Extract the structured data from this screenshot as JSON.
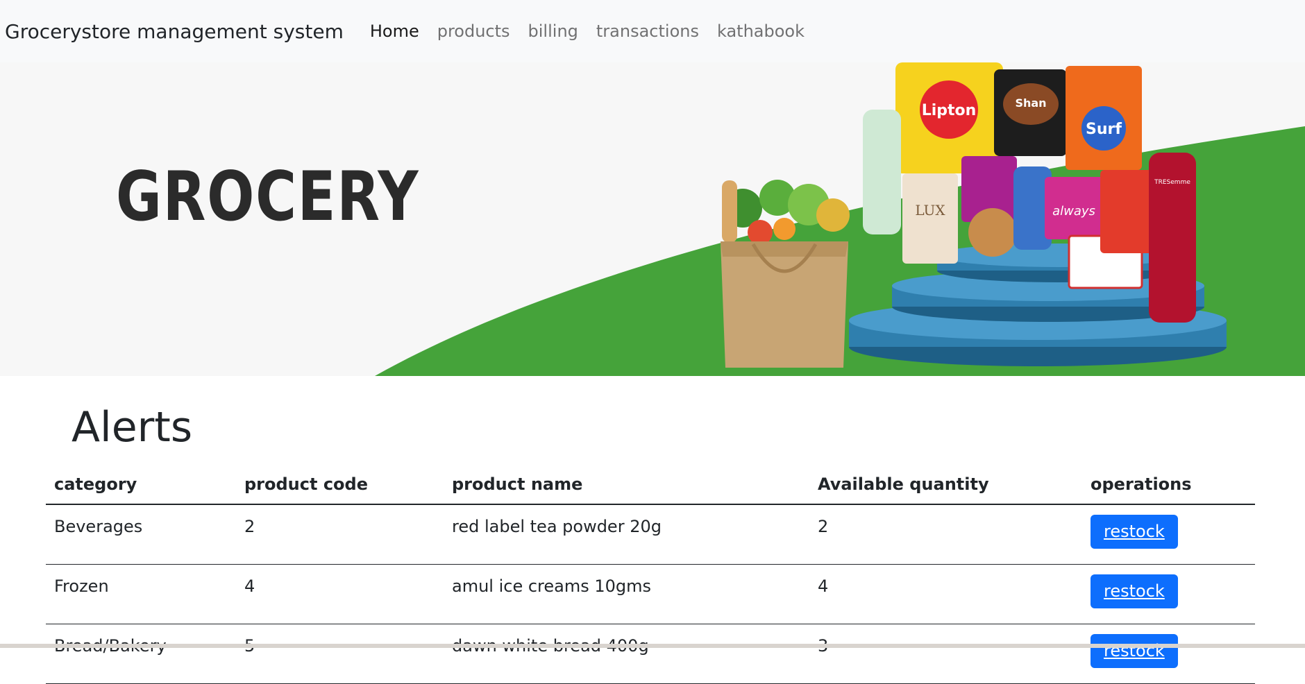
{
  "navbar": {
    "brand": "Grocerystore management system",
    "links": [
      "Home",
      "products",
      "billing",
      "transactions",
      "kathabook"
    ]
  },
  "banner": {
    "title": "GROCERY",
    "brand_labels": [
      "Lipton",
      "Shan",
      "Surf",
      "LUX",
      "always",
      "TRESemme"
    ]
  },
  "alerts": {
    "title": "Alerts",
    "columns": [
      "category",
      "product code",
      "product name",
      "Available quantity",
      "operations"
    ],
    "rows": [
      {
        "category": "Beverages",
        "code": "2",
        "name": "red label tea powder 20g",
        "qty": "2",
        "action": "restock"
      },
      {
        "category": "Frozen",
        "code": "4",
        "name": "amul ice creams 10gms",
        "qty": "4",
        "action": "restock"
      },
      {
        "category": "Bread/Bakery",
        "code": "5",
        "name": "dawn white bread 400g",
        "qty": "3",
        "action": "restock"
      }
    ]
  },
  "colors": {
    "primary": "#0d6efd",
    "green": "#45a33a",
    "podium": "#2f7fae",
    "navbar_bg": "#f8f9fa"
  }
}
